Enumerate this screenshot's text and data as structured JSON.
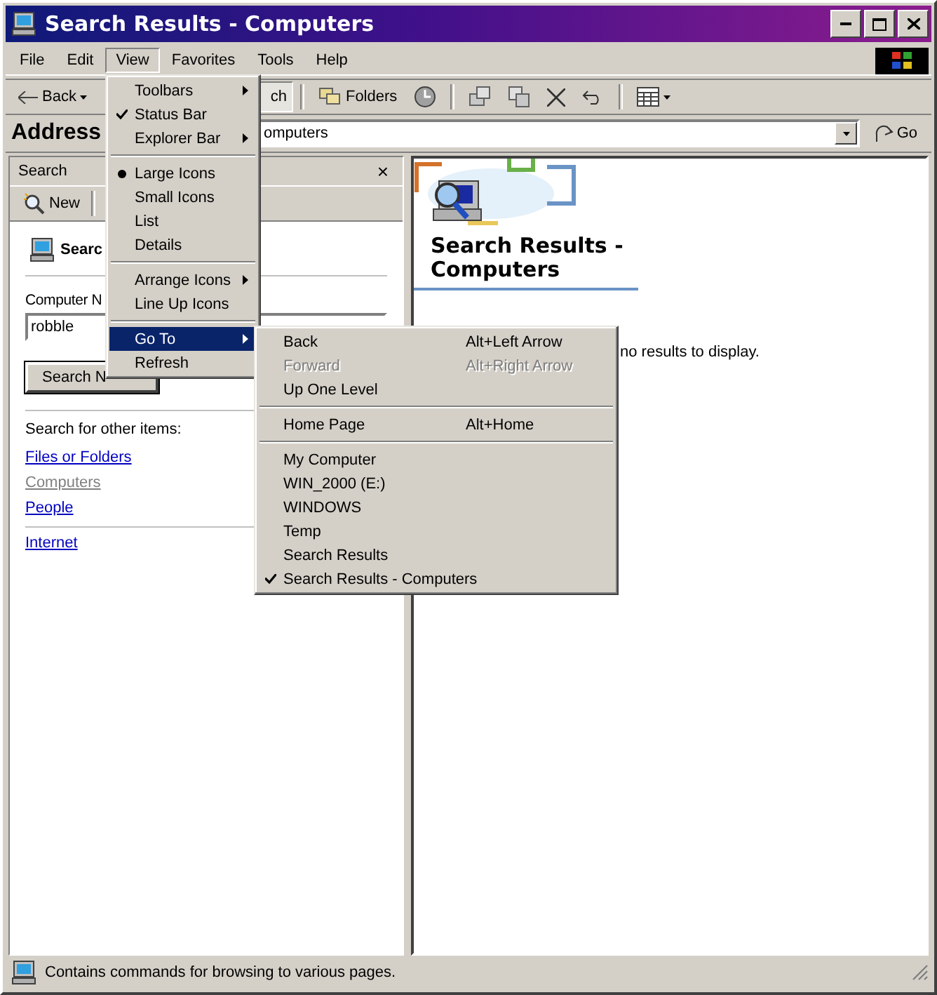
{
  "window": {
    "title": "Search Results - Computers"
  },
  "menu_bar": [
    {
      "label": "File",
      "selected": false
    },
    {
      "label": "Edit",
      "selected": false
    },
    {
      "label": "View",
      "selected": true
    },
    {
      "label": "Favorites",
      "selected": false
    },
    {
      "label": "Tools",
      "selected": false
    },
    {
      "label": "Help",
      "selected": false
    }
  ],
  "toolbar": {
    "back": "Back",
    "search_partial": "ch",
    "folders": "Folders"
  },
  "address_bar": {
    "label": "Address",
    "value": "omputers",
    "go": "Go"
  },
  "search_pane": {
    "title": "Search",
    "close": "×",
    "new": "New",
    "heading": "Searc",
    "field_label": "Computer N",
    "field_value": "robble",
    "button": "Search N",
    "other_label": "Search for other items:",
    "links": [
      {
        "label": "Files or Folders",
        "disabled": false
      },
      {
        "label": "Computers",
        "disabled": true
      },
      {
        "label": "People",
        "disabled": false
      }
    ],
    "extra_links": [
      {
        "label": "Internet",
        "disabled": false
      }
    ]
  },
  "results": {
    "heading": "Search Results - Computers",
    "message": "no results to display."
  },
  "view_menu": [
    {
      "kind": "submenu",
      "label": "Toolbars",
      "highlighted": false
    },
    {
      "kind": "check",
      "label": "Status Bar",
      "checked": true,
      "highlighted": false
    },
    {
      "kind": "submenu",
      "label": "Explorer Bar",
      "highlighted": false
    },
    {
      "kind": "separator"
    },
    {
      "kind": "radio",
      "label": "Large Icons",
      "selected": true,
      "highlighted": false
    },
    {
      "kind": "radio",
      "label": "Small Icons",
      "selected": false,
      "highlighted": false
    },
    {
      "kind": "radio",
      "label": "List",
      "selected": false,
      "highlighted": false
    },
    {
      "kind": "radio",
      "label": "Details",
      "selected": false,
      "highlighted": false
    },
    {
      "kind": "separator"
    },
    {
      "kind": "submenu",
      "label": "Arrange Icons",
      "highlighted": false
    },
    {
      "kind": "command",
      "label": "Line Up Icons",
      "highlighted": false
    },
    {
      "kind": "separator"
    },
    {
      "kind": "submenu",
      "label": "Go To",
      "highlighted": true
    },
    {
      "kind": "command",
      "label": "Refresh",
      "highlighted": false
    }
  ],
  "go_to_menu": [
    {
      "kind": "item",
      "label": "Back",
      "shortcut": "Alt+Left Arrow",
      "disabled": false,
      "checked": false
    },
    {
      "kind": "item",
      "label": "Forward",
      "shortcut": "Alt+Right Arrow",
      "disabled": true,
      "checked": false
    },
    {
      "kind": "item",
      "label": "Up One Level",
      "disabled": false,
      "checked": false
    },
    {
      "kind": "separator"
    },
    {
      "kind": "item",
      "label": "Home Page",
      "shortcut": "Alt+Home",
      "disabled": false,
      "checked": false
    },
    {
      "kind": "separator"
    },
    {
      "kind": "item",
      "label": "My Computer",
      "disabled": false,
      "checked": false
    },
    {
      "kind": "item",
      "label": "WIN_2000 (E:)",
      "disabled": false,
      "checked": false
    },
    {
      "kind": "item",
      "label": "WINDOWS",
      "disabled": false,
      "checked": false
    },
    {
      "kind": "item",
      "label": "Temp",
      "disabled": false,
      "checked": false
    },
    {
      "kind": "item",
      "label": "Search Results",
      "disabled": false,
      "checked": false
    },
    {
      "kind": "item",
      "label": "Search Results - Computers",
      "disabled": false,
      "checked": true
    }
  ],
  "status_bar": {
    "text": "Contains commands for browsing to various pages."
  }
}
